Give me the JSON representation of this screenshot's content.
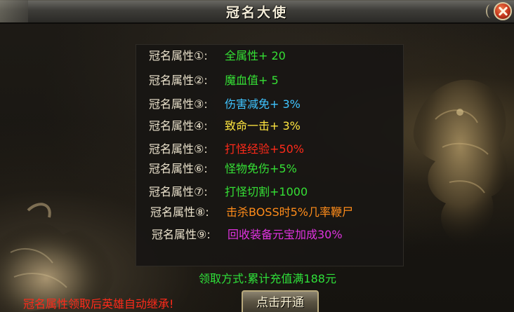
{
  "window": {
    "title": "冠名大使"
  },
  "attributes": [
    {
      "label": "冠名属性①:",
      "value": "全属性+ 20",
      "color": "#35e035"
    },
    {
      "label": "冠名属性②:",
      "value": "魔血值+ 5",
      "color": "#35e035"
    },
    {
      "label": "冠名属性③:",
      "value": "伤害减免+ 3%",
      "color": "#3fc4ff"
    },
    {
      "label": "冠名属性④:",
      "value": "致命一击+ 3%",
      "color": "#ffe640"
    },
    {
      "label": "冠名属性⑤:",
      "value": "打怪经验+50%",
      "color": "#ff2a1a"
    },
    {
      "label": "冠名属性⑥:",
      "value": "怪物免伤+5%",
      "color": "#35e035"
    },
    {
      "label": "冠名属性⑦:",
      "value": "打怪切割+1000",
      "color": "#35e035"
    },
    {
      "label": "冠名属性⑧:",
      "value": "击杀BOSS时5%几率鞭尸",
      "color": "#ff8c1a"
    },
    {
      "label": "冠名属性⑨:",
      "value": "回收装备元宝加成30%",
      "color": "#e033e0"
    }
  ],
  "method": "领取方式:累计充值满188元",
  "notice": "冠名属性领取后英雄自动继承!",
  "activate_button": "点击开通",
  "close_icon": "close-icon"
}
